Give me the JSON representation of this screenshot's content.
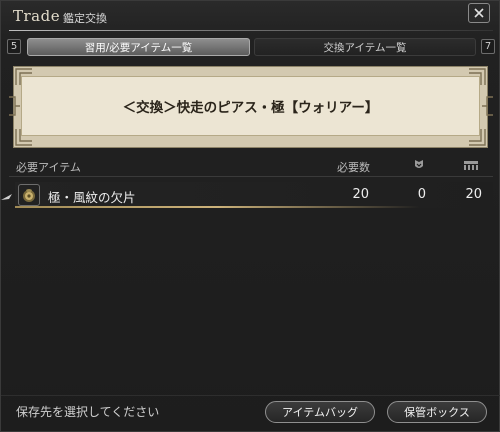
{
  "window": {
    "title": "Trade",
    "subtitle": "鑑定交換"
  },
  "tabs": {
    "left_key": "5",
    "right_key": "7",
    "items": [
      {
        "label": "習用/必要アイテム一覧",
        "active": true
      },
      {
        "label": "交換アイテム一覧",
        "active": false
      }
    ]
  },
  "banner": {
    "text": "＜交換＞快走のピアス・極【ウォリアー】"
  },
  "table": {
    "header": {
      "item_col": "必要アイテム",
      "required_col": "必要数",
      "col2_icon": "armory-chest-icon",
      "col3_icon": "inventory-icon"
    },
    "rows": [
      {
        "name": "極・風紋の欠片",
        "required": "20",
        "col2": "0",
        "col3": "20",
        "icon": "coin-pouch-icon"
      }
    ]
  },
  "footer": {
    "prompt": "保存先を選択してください",
    "bag_button": "アイテムバッグ",
    "box_button": "保管ボックス"
  },
  "colors": {
    "accent_gold": "#ccb27a",
    "banner_parchment": "#ece5d3"
  }
}
